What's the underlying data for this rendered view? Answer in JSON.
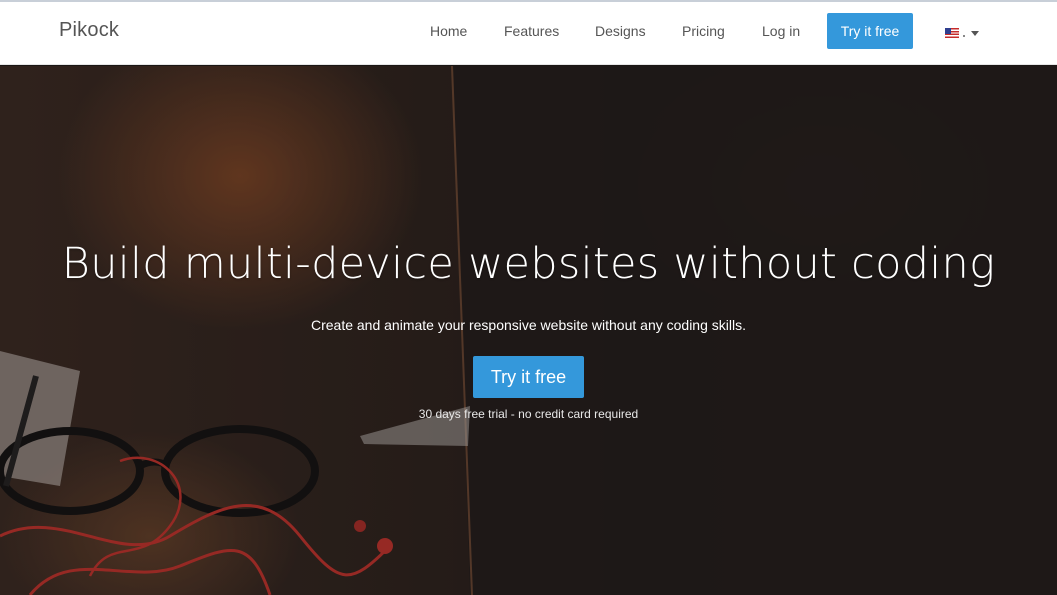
{
  "header": {
    "brand": "Pikock",
    "nav": [
      {
        "label": "Home"
      },
      {
        "label": "Features"
      },
      {
        "label": "Designs"
      },
      {
        "label": "Pricing"
      },
      {
        "label": "Log in"
      }
    ],
    "cta_label": "Try it free",
    "language_icon": "us-flag-icon"
  },
  "hero": {
    "title": "Build multi-device websites without coding",
    "subtitle": "Create and animate your responsive website without any coding skills.",
    "cta_label": "Try it free",
    "note": "30 days free trial - no credit card required"
  },
  "colors": {
    "accent": "#3498db",
    "header_bg": "#ffffff",
    "nav_text": "#555555",
    "hero_text": "#ffffff"
  }
}
